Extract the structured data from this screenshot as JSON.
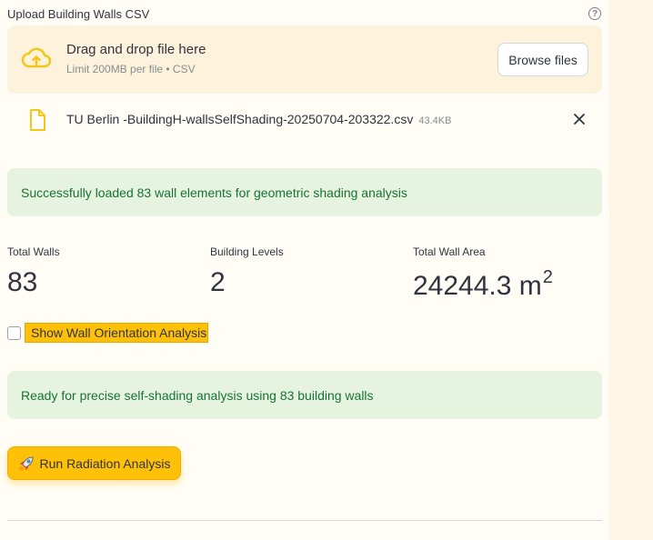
{
  "uploader": {
    "label": "Upload Building Walls CSV",
    "help_icon": "question-circle-icon",
    "dropzone_title": "Drag and drop file here",
    "dropzone_limit": "Limit 200MB per file • CSV",
    "browse_label": "Browse files",
    "upload_icon": "cloud-upload-icon"
  },
  "file": {
    "icon": "file-icon",
    "name": "TU Berlin -BuildingH-wallsSelfShading-20250704-203322.csv",
    "size": "43.4KB",
    "remove_icon": "close-icon"
  },
  "success_message": "Successfully loaded 83 wall elements for geometric shading analysis",
  "metrics": [
    {
      "label": "Total Walls",
      "value": "83"
    },
    {
      "label": "Building Levels",
      "value": "2"
    },
    {
      "label": "Total Wall Area",
      "value": "24244.3 m",
      "unit_sup": "2"
    }
  ],
  "orientation_checkbox": {
    "label": "Show Wall Orientation Analysis",
    "checked": false
  },
  "ready_message": "Ready for precise self-shading analysis using 83 building walls",
  "run_button": {
    "label": "Run Radiation Analysis",
    "icon": "rocket-icon"
  },
  "colors": {
    "accent": "#ffc107",
    "success_bg": "#e6f4df",
    "success_text": "#177233",
    "dropzone_bg": "#fdf3dc",
    "page_bg": "#fffdf6"
  }
}
